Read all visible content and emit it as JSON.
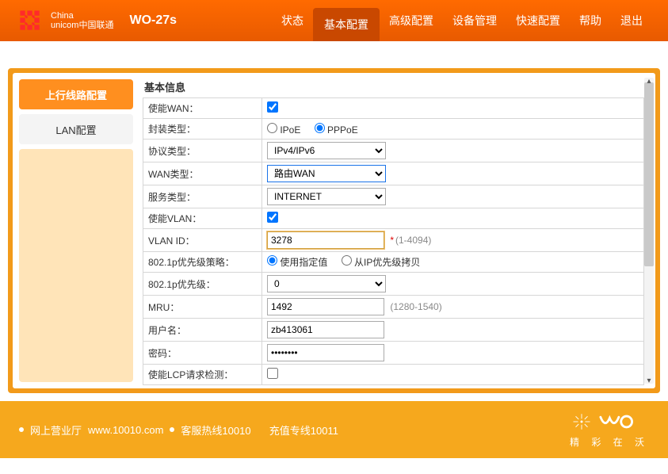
{
  "header": {
    "brand_line1": "China",
    "brand_line2": "unicom中国联通",
    "model": "WO-27s",
    "nav": {
      "status": "状态",
      "basic": "基本配置",
      "advanced": "高级配置",
      "device": "设备管理",
      "quick": "快速配置",
      "help": "帮助",
      "logout": "退出"
    }
  },
  "sidebar": {
    "uplink": "上行线路配置",
    "lan": "LAN配置"
  },
  "section_title": "基本信息",
  "form": {
    "enable_wan_label": "使能WAN：",
    "encapsulation_label": "封装类型：",
    "encapsulation_ipoe": "IPoE",
    "encapsulation_pppoe": "PPPoE",
    "protocol_label": "协议类型：",
    "protocol_value": "IPv4/IPv6",
    "wan_type_label": "WAN类型：",
    "wan_type_value": "路由WAN",
    "service_type_label": "服务类型：",
    "service_type_value": "INTERNET",
    "enable_vlan_label": "使能VLAN：",
    "vlan_id_label": "VLAN ID：",
    "vlan_id_value": "3278",
    "vlan_id_hint": "(1-4094)",
    "p8021_policy_label": "802.1p优先级策略：",
    "p8021_policy_opt1": "使用指定值",
    "p8021_policy_opt2": "从IP优先级拷贝",
    "p8021_priority_label": "802.1p优先级：",
    "p8021_priority_value": "0",
    "mru_label": "MRU：",
    "mru_value": "1492",
    "mru_hint": "(1280-1540)",
    "username_label": "用户名：",
    "username_value": "zb413061",
    "password_label": "密码：",
    "password_value": "••••••••",
    "lcp_label": "使能LCP请求检测："
  },
  "footer": {
    "online_hall": "网上营业厅",
    "url": "www.10010.com",
    "hotline": "客服热线10010",
    "recharge": "充值专线10011",
    "wo_tagline": "精 彩 在 沃"
  }
}
